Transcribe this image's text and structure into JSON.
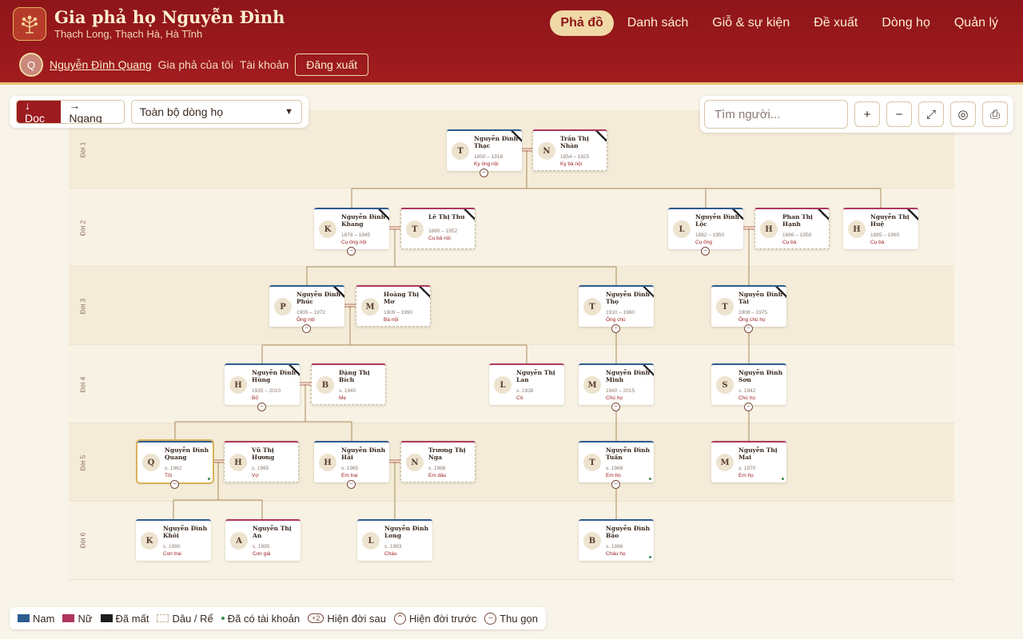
{
  "header": {
    "title": "Gia phả họ Nguyễn Đình",
    "subtitle": "Thạch Long, Thạch Hà, Hà Tĩnh",
    "nav": [
      "Phả đồ",
      "Danh sách",
      "Giỗ & sự kiện",
      "Đề xuất",
      "Dòng họ",
      "Quản lý"
    ],
    "active_nav": "Phả đồ",
    "user_initial": "Q",
    "user_name": "Nguyễn Đình Quang",
    "my_tree": "Gia phả của tôi",
    "account": "Tài khoản",
    "logout": "Đăng xuất"
  },
  "toolbar": {
    "vertical": "↓ Dọc",
    "horizontal": "→ Ngang",
    "scope": "Toàn bộ dòng họ",
    "search_placeholder": "Tìm người...",
    "zoom_in": "+",
    "zoom_out": "−",
    "fit": "⤢",
    "center": "◎",
    "export": "⎙"
  },
  "generations": [
    "Đời 1",
    "Đời 2",
    "Đời 3",
    "Đời 4",
    "Đời 5",
    "Đời 6"
  ],
  "people": [
    {
      "initial": "T",
      "name": "Nguyễn Đình Thạc",
      "years": "1850 – 1918",
      "role": "Kỵ ông nội"
    },
    {
      "initial": "N",
      "name": "Trần Thị Nhàn",
      "years": "1854 – 1925",
      "role": "Kỵ bà nội"
    },
    {
      "initial": "K",
      "name": "Nguyễn Đình Khang",
      "years": "1878 – 1945",
      "role": "Cụ ông nội"
    },
    {
      "initial": "T",
      "name": "Lê Thị Thu",
      "years": "1880 – 1952",
      "role": "Cụ bà nội"
    },
    {
      "initial": "L",
      "name": "Nguyễn Đình Lộc",
      "years": "1882 – 1950",
      "role": "Cụ ông"
    },
    {
      "initial": "H",
      "name": "Phan Thị Hạnh",
      "years": "1886 – 1958",
      "role": "Cụ bà"
    },
    {
      "initial": "H",
      "name": "Nguyễn Thị Huệ",
      "years": "1885 – 1960",
      "role": "Cụ bà"
    },
    {
      "initial": "P",
      "name": "Nguyễn Đình Phúc",
      "years": "1905 – 1972",
      "role": "Ông nội"
    },
    {
      "initial": "M",
      "name": "Hoàng Thị Mơ",
      "years": "1909 – 1990",
      "role": "Bà nội"
    },
    {
      "initial": "T",
      "name": "Nguyễn Đình Thọ",
      "years": "1910 – 1980",
      "role": "Ông chú"
    },
    {
      "initial": "T",
      "name": "Nguyễn Đình Tài",
      "years": "1908 – 1975",
      "role": "Ông chú họ"
    },
    {
      "initial": "H",
      "name": "Nguyễn Đình Hùng",
      "years": "1935 – 2010",
      "role": "Bố"
    },
    {
      "initial": "B",
      "name": "Đặng Thị Bích",
      "years": "s. 1940",
      "role": "Mẹ"
    },
    {
      "initial": "L",
      "name": "Nguyễn Thị Lan",
      "years": "s. 1938",
      "role": "Cô"
    },
    {
      "initial": "M",
      "name": "Nguyễn Đình Minh",
      "years": "1940 – 2015",
      "role": "Chú họ"
    },
    {
      "initial": "S",
      "name": "Nguyễn Đình Sơn",
      "years": "s. 1942",
      "role": "Chú họ"
    },
    {
      "initial": "Q",
      "name": "Nguyễn Đình Quang",
      "years": "s. 1962",
      "role": "Tôi"
    },
    {
      "initial": "H",
      "name": "Vũ Thị Hương",
      "years": "s. 1965",
      "role": "Vợ"
    },
    {
      "initial": "H",
      "name": "Nguyễn Đình Hải",
      "years": "s. 1965",
      "role": "Em trai"
    },
    {
      "initial": "N",
      "name": "Trương Thị Nga",
      "years": "s. 1968",
      "role": "Em dâu"
    },
    {
      "initial": "T",
      "name": "Nguyễn Đình Tuấn",
      "years": "s. 1968",
      "role": "Em họ"
    },
    {
      "initial": "M",
      "name": "Nguyễn Thị Mai",
      "years": "s. 1970",
      "role": "Em họ"
    },
    {
      "initial": "K",
      "name": "Nguyễn Đình Khôi",
      "years": "s. 1990",
      "role": "Con trai"
    },
    {
      "initial": "A",
      "name": "Nguyễn Thị An",
      "years": "s. 1995",
      "role": "Con gái"
    },
    {
      "initial": "L",
      "name": "Nguyễn Đình Long",
      "years": "s. 1993",
      "role": "Cháu"
    },
    {
      "initial": "B",
      "name": "Nguyễn Đình Bảo",
      "years": "s. 1996",
      "role": "Cháu họ"
    }
  ],
  "legend": {
    "male": "Nam",
    "female": "Nữ",
    "deceased": "Đã mất",
    "in_law": "Dâu / Rể",
    "has_account": "Đã có tài khoản",
    "badge": "+2",
    "show_descendants": "Hiện đời sau",
    "show_ancestors": "Hiện đời trước",
    "collapse": "Thu gọn",
    "colors": {
      "male": "#2e5b8f",
      "female": "#b0365f",
      "deceased": "#1e1e1e"
    }
  }
}
